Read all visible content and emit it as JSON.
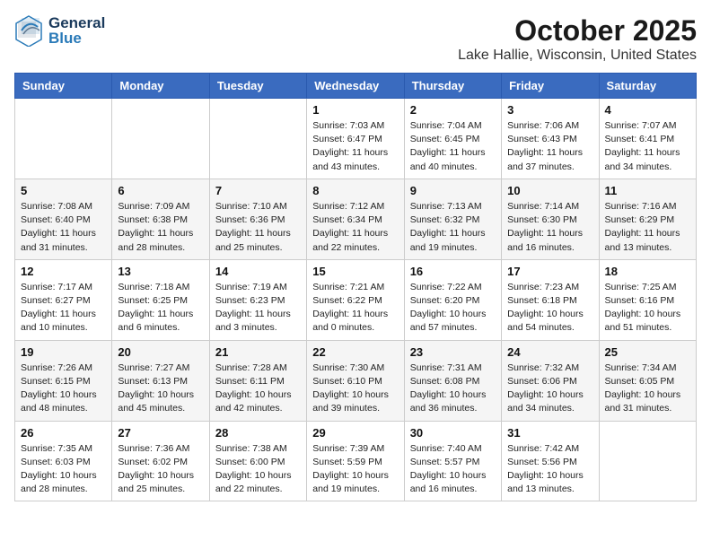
{
  "header": {
    "logo_general": "General",
    "logo_blue": "Blue",
    "month_title": "October 2025",
    "location": "Lake Hallie, Wisconsin, United States"
  },
  "calendar": {
    "days_of_week": [
      "Sunday",
      "Monday",
      "Tuesday",
      "Wednesday",
      "Thursday",
      "Friday",
      "Saturday"
    ],
    "weeks": [
      [
        {
          "day": "",
          "info": ""
        },
        {
          "day": "",
          "info": ""
        },
        {
          "day": "",
          "info": ""
        },
        {
          "day": "1",
          "info": "Sunrise: 7:03 AM\nSunset: 6:47 PM\nDaylight: 11 hours\nand 43 minutes."
        },
        {
          "day": "2",
          "info": "Sunrise: 7:04 AM\nSunset: 6:45 PM\nDaylight: 11 hours\nand 40 minutes."
        },
        {
          "day": "3",
          "info": "Sunrise: 7:06 AM\nSunset: 6:43 PM\nDaylight: 11 hours\nand 37 minutes."
        },
        {
          "day": "4",
          "info": "Sunrise: 7:07 AM\nSunset: 6:41 PM\nDaylight: 11 hours\nand 34 minutes."
        }
      ],
      [
        {
          "day": "5",
          "info": "Sunrise: 7:08 AM\nSunset: 6:40 PM\nDaylight: 11 hours\nand 31 minutes."
        },
        {
          "day": "6",
          "info": "Sunrise: 7:09 AM\nSunset: 6:38 PM\nDaylight: 11 hours\nand 28 minutes."
        },
        {
          "day": "7",
          "info": "Sunrise: 7:10 AM\nSunset: 6:36 PM\nDaylight: 11 hours\nand 25 minutes."
        },
        {
          "day": "8",
          "info": "Sunrise: 7:12 AM\nSunset: 6:34 PM\nDaylight: 11 hours\nand 22 minutes."
        },
        {
          "day": "9",
          "info": "Sunrise: 7:13 AM\nSunset: 6:32 PM\nDaylight: 11 hours\nand 19 minutes."
        },
        {
          "day": "10",
          "info": "Sunrise: 7:14 AM\nSunset: 6:30 PM\nDaylight: 11 hours\nand 16 minutes."
        },
        {
          "day": "11",
          "info": "Sunrise: 7:16 AM\nSunset: 6:29 PM\nDaylight: 11 hours\nand 13 minutes."
        }
      ],
      [
        {
          "day": "12",
          "info": "Sunrise: 7:17 AM\nSunset: 6:27 PM\nDaylight: 11 hours\nand 10 minutes."
        },
        {
          "day": "13",
          "info": "Sunrise: 7:18 AM\nSunset: 6:25 PM\nDaylight: 11 hours\nand 6 minutes."
        },
        {
          "day": "14",
          "info": "Sunrise: 7:19 AM\nSunset: 6:23 PM\nDaylight: 11 hours\nand 3 minutes."
        },
        {
          "day": "15",
          "info": "Sunrise: 7:21 AM\nSunset: 6:22 PM\nDaylight: 11 hours\nand 0 minutes."
        },
        {
          "day": "16",
          "info": "Sunrise: 7:22 AM\nSunset: 6:20 PM\nDaylight: 10 hours\nand 57 minutes."
        },
        {
          "day": "17",
          "info": "Sunrise: 7:23 AM\nSunset: 6:18 PM\nDaylight: 10 hours\nand 54 minutes."
        },
        {
          "day": "18",
          "info": "Sunrise: 7:25 AM\nSunset: 6:16 PM\nDaylight: 10 hours\nand 51 minutes."
        }
      ],
      [
        {
          "day": "19",
          "info": "Sunrise: 7:26 AM\nSunset: 6:15 PM\nDaylight: 10 hours\nand 48 minutes."
        },
        {
          "day": "20",
          "info": "Sunrise: 7:27 AM\nSunset: 6:13 PM\nDaylight: 10 hours\nand 45 minutes."
        },
        {
          "day": "21",
          "info": "Sunrise: 7:28 AM\nSunset: 6:11 PM\nDaylight: 10 hours\nand 42 minutes."
        },
        {
          "day": "22",
          "info": "Sunrise: 7:30 AM\nSunset: 6:10 PM\nDaylight: 10 hours\nand 39 minutes."
        },
        {
          "day": "23",
          "info": "Sunrise: 7:31 AM\nSunset: 6:08 PM\nDaylight: 10 hours\nand 36 minutes."
        },
        {
          "day": "24",
          "info": "Sunrise: 7:32 AM\nSunset: 6:06 PM\nDaylight: 10 hours\nand 34 minutes."
        },
        {
          "day": "25",
          "info": "Sunrise: 7:34 AM\nSunset: 6:05 PM\nDaylight: 10 hours\nand 31 minutes."
        }
      ],
      [
        {
          "day": "26",
          "info": "Sunrise: 7:35 AM\nSunset: 6:03 PM\nDaylight: 10 hours\nand 28 minutes."
        },
        {
          "day": "27",
          "info": "Sunrise: 7:36 AM\nSunset: 6:02 PM\nDaylight: 10 hours\nand 25 minutes."
        },
        {
          "day": "28",
          "info": "Sunrise: 7:38 AM\nSunset: 6:00 PM\nDaylight: 10 hours\nand 22 minutes."
        },
        {
          "day": "29",
          "info": "Sunrise: 7:39 AM\nSunset: 5:59 PM\nDaylight: 10 hours\nand 19 minutes."
        },
        {
          "day": "30",
          "info": "Sunrise: 7:40 AM\nSunset: 5:57 PM\nDaylight: 10 hours\nand 16 minutes."
        },
        {
          "day": "31",
          "info": "Sunrise: 7:42 AM\nSunset: 5:56 PM\nDaylight: 10 hours\nand 13 minutes."
        },
        {
          "day": "",
          "info": ""
        }
      ]
    ]
  }
}
